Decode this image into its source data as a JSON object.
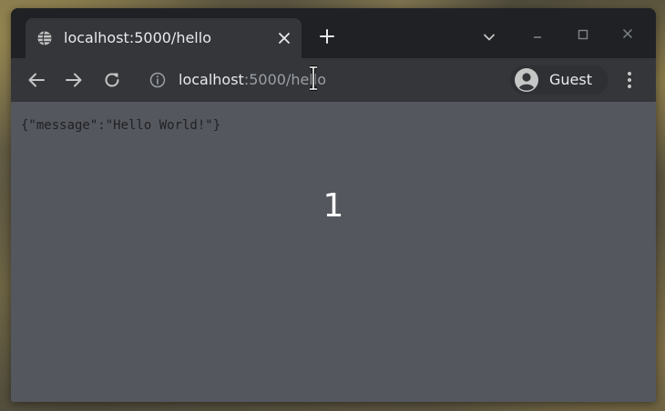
{
  "browser": {
    "tab": {
      "title": "localhost:5000/hello",
      "favicon": "globe-icon"
    },
    "window_controls": [
      "minimize-icon",
      "maximize-icon",
      "close-icon"
    ],
    "toolbar": {
      "url_host": "localhost",
      "url_rest": ":5000/hello",
      "profile_label": "Guest"
    }
  },
  "page": {
    "json_text": "{\"message\":\"Hello World!\"}",
    "overlay_number": "1"
  },
  "colors": {
    "frame": "#202124",
    "toolbar": "#35363a",
    "content_background": "#55575e",
    "text_primary": "#e8eaed",
    "text_secondary": "#9aa0a6"
  }
}
